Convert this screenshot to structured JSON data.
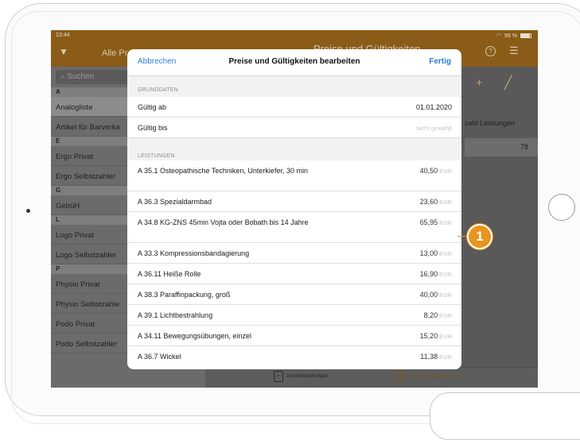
{
  "statusbar": {
    "time": "13:44",
    "battery": "99 %"
  },
  "navbar": {
    "left_title": "Alle Pr",
    "center_title": "Preise und Gültigkeiten"
  },
  "sidebar": {
    "search_placeholder": "Suchen",
    "sections": {
      "a": "A",
      "e": "E",
      "g": "G",
      "l": "L",
      "p": "P"
    },
    "items": [
      "Analogliste",
      "Artikel für Barverka",
      "Ergo Privat",
      "Ergo Selbstzahler",
      "GebüH",
      "Logo Privat",
      "Logo Selbstzahler",
      "Physio Privat",
      "Physio Selbstzahle",
      "Podo Privat",
      "Podo Selbstzahler"
    ]
  },
  "rightpane": {
    "column_header": "zahl Leistungen",
    "column_value": "78"
  },
  "tabbar": {
    "tabs": [
      {
        "label": "Grundeinstellungen",
        "active": false
      },
      {
        "label": "Preise und Gültigkeiten",
        "active": true
      }
    ]
  },
  "modal": {
    "cancel": "Abbrechen",
    "title": "Preise und Gültigkeiten bearbeiten",
    "done": "Fertig",
    "grunddaten_label": "GRUNDDATEN",
    "valid_from_label": "Gültig ab",
    "valid_from_value": "01.01.2020",
    "valid_to_label": "Gültig bis",
    "valid_to_placeholder": "Nicht gewählt",
    "leistungen_label": "LEISTUNGEN",
    "currency": "EUR",
    "services": [
      {
        "name": "A 35.1 Osteopathische Techniken, Unterkiefer, 30 min",
        "price": "40,50"
      },
      {
        "name": "A 36.3 Spezialdarmbad",
        "price": "23,60"
      },
      {
        "name": "A 34.8 KG-ZNS  45min Vojta oder Bobath bis 14 Jahre",
        "price": "65,95"
      },
      {
        "name": "A 33.3 Kompressionsbandagierung",
        "price": "13,00"
      },
      {
        "name": "A 36.11 Heiße Rolle",
        "price": "16,90"
      },
      {
        "name": "A 38.3 Paraffinpackung, groß",
        "price": "40,00"
      },
      {
        "name": "A 39.1 Lichtbestrahlung",
        "price": "8,20"
      },
      {
        "name": "A 34.11 Bewegungsübungen, einzel",
        "price": "15,20"
      },
      {
        "name": "A 36.7 Wickel",
        "price": "11,38"
      }
    ]
  },
  "callout": {
    "number": "1"
  },
  "colors": {
    "accent": "#2e7bd6",
    "navbar": "#8a5c18",
    "callout": "#e8941f"
  }
}
